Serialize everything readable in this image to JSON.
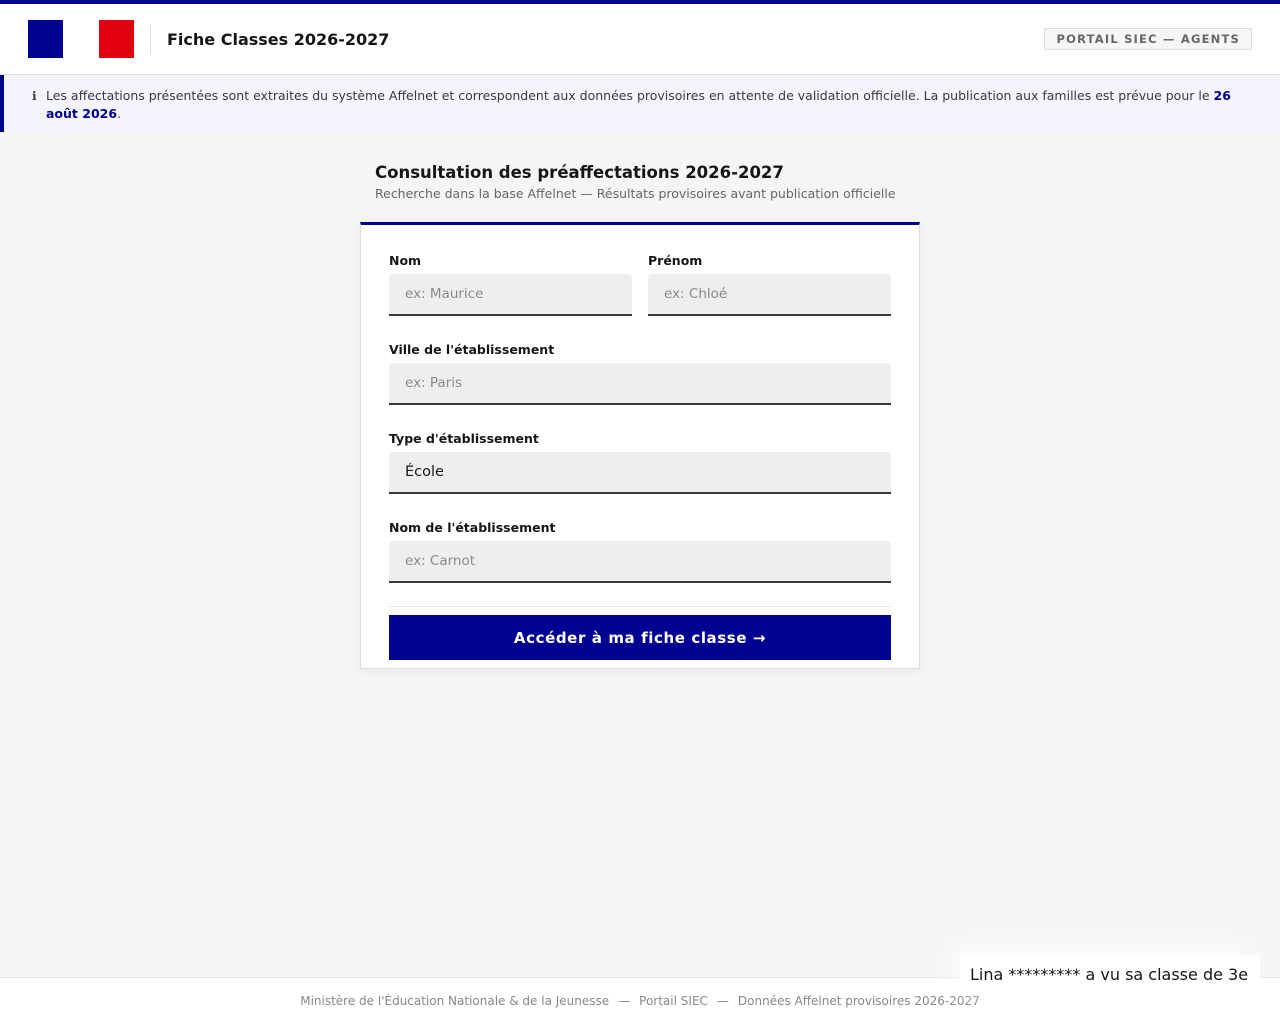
{
  "header": {
    "title": "Fiche Classes 2026-2027",
    "badge": "PORTAIL SIEC — AGENTS",
    "flag_colors": [
      "#000091",
      "#ffffff",
      "#e1000f"
    ]
  },
  "notice": {
    "icon": "info-icon",
    "text": "Les affectations présentées sont extraites du système Affelnet et correspondent aux données provisoires en attente de validation officielle. La publication aux familles est prévue pour le ",
    "date": "26 août 2026",
    "end": "."
  },
  "page": {
    "title": "Consultation des préaffectations 2026-2027",
    "subtitle": "Recherche dans la base Affelnet — Résultats provisoires avant publication officielle"
  },
  "form": {
    "nom": {
      "label": "Nom",
      "placeholder": "ex: Maurice",
      "value": ""
    },
    "prenom": {
      "label": "Prénom",
      "placeholder": "ex: Chloé",
      "value": ""
    },
    "ville": {
      "label": "Ville de l'établissement",
      "placeholder": "ex: Paris",
      "value": ""
    },
    "type": {
      "label": "Type d'établissement",
      "value": "École"
    },
    "etablissement": {
      "label": "Nom de l'établissement",
      "placeholder": "ex: Carnot",
      "value": ""
    },
    "submit": "Accéder à ma fiche classe →"
  },
  "footer": {
    "items": [
      "Ministère de l'Éducation Nationale & de la Jeunesse",
      "Portail SIEC",
      "Données Affelnet provisoires 2026-2027"
    ],
    "separator": "—"
  },
  "toast": {
    "text": "Lina ********* a vu sa classe de 3e"
  },
  "colors": {
    "accent": "#000091",
    "red": "#e1000f",
    "background": "#f5f5f5"
  }
}
